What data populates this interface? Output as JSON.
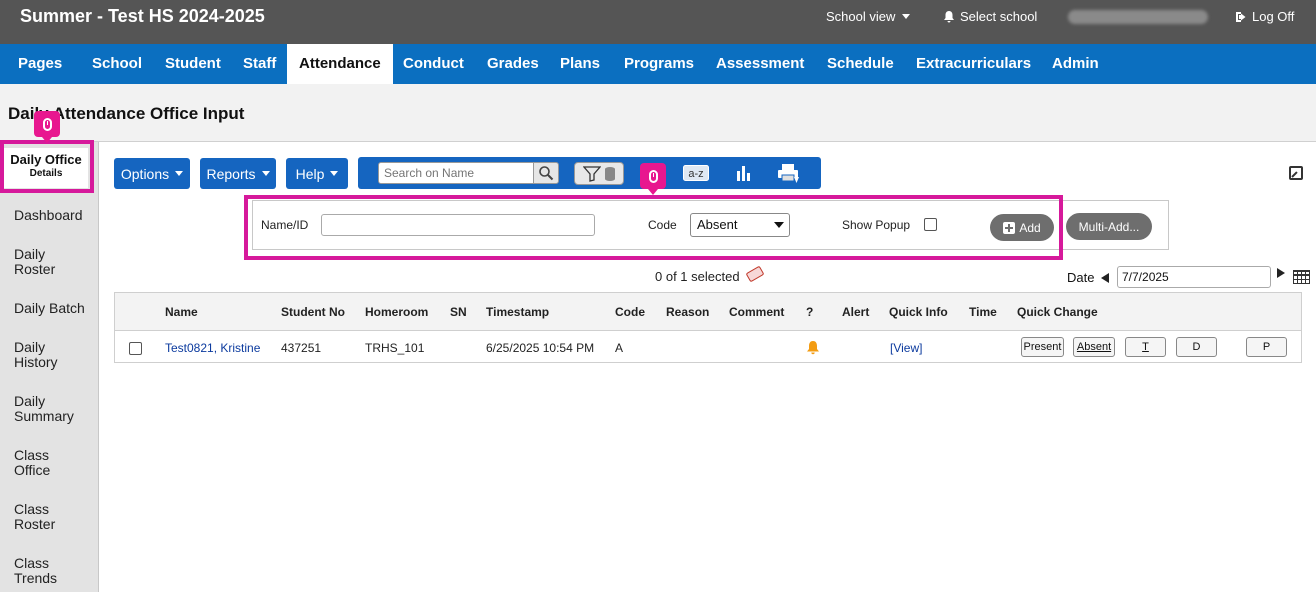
{
  "app": {
    "title": "Summer - Test HS 2024-2025",
    "school_view": "School view",
    "select_school": "Select school",
    "log_off": "Log Off"
  },
  "nav": {
    "items": [
      "Pages",
      "School",
      "Student",
      "Staff",
      "Attendance",
      "Conduct",
      "Grades",
      "Plans",
      "Programs",
      "Assessment",
      "Schedule",
      "Extracurriculars",
      "Admin"
    ],
    "active": "Attendance"
  },
  "page": {
    "title": "Daily Attendance Office Input"
  },
  "sidebar": {
    "active_title": "Daily Office",
    "active_sub": "Details",
    "items": [
      {
        "l1": "Dashboard",
        "l2": ""
      },
      {
        "l1": "Daily",
        "l2": "Roster"
      },
      {
        "l1": "Daily Batch",
        "l2": ""
      },
      {
        "l1": "Daily",
        "l2": "History"
      },
      {
        "l1": "Daily",
        "l2": "Summary"
      },
      {
        "l1": "Class",
        "l2": "Office"
      },
      {
        "l1": "Class",
        "l2": "Roster"
      },
      {
        "l1": "Class",
        "l2": "Trends"
      }
    ]
  },
  "toolbar": {
    "options": "Options",
    "reports": "Reports",
    "help": "Help",
    "search_placeholder": "Search on Name",
    "sort_label": "a-z"
  },
  "input_panel": {
    "name_label": "Name/ID",
    "name_value": "",
    "code_label": "Code",
    "code_value": "Absent",
    "show_popup_label": "Show Popup",
    "add_label": "Add",
    "multi_add_label": "Multi-Add..."
  },
  "selection": {
    "text": "0 of 1 selected"
  },
  "date": {
    "label": "Date",
    "value": "7/7/2025"
  },
  "table": {
    "headers": [
      "Name",
      "Student No",
      "Homeroom",
      "SN",
      "Timestamp",
      "Code",
      "Reason",
      "Comment",
      "?",
      "Alert",
      "Quick Info",
      "Time",
      "Quick Change"
    ],
    "rows": [
      {
        "name": "Test0821, Kristine",
        "student_no": "437251",
        "homeroom": "TRHS_101",
        "sn": "",
        "timestamp": "6/25/2025 10:54 PM",
        "code": "A",
        "reason": "",
        "comment": "",
        "quick_info": "[View]",
        "quick_change": [
          "Present",
          "Absent",
          "T",
          "D",
          "P"
        ]
      }
    ]
  },
  "colors": {
    "nav": "#0b6fc0",
    "topbar": "#555555",
    "highlight": "#d6199b",
    "bell": "#f39c12"
  }
}
